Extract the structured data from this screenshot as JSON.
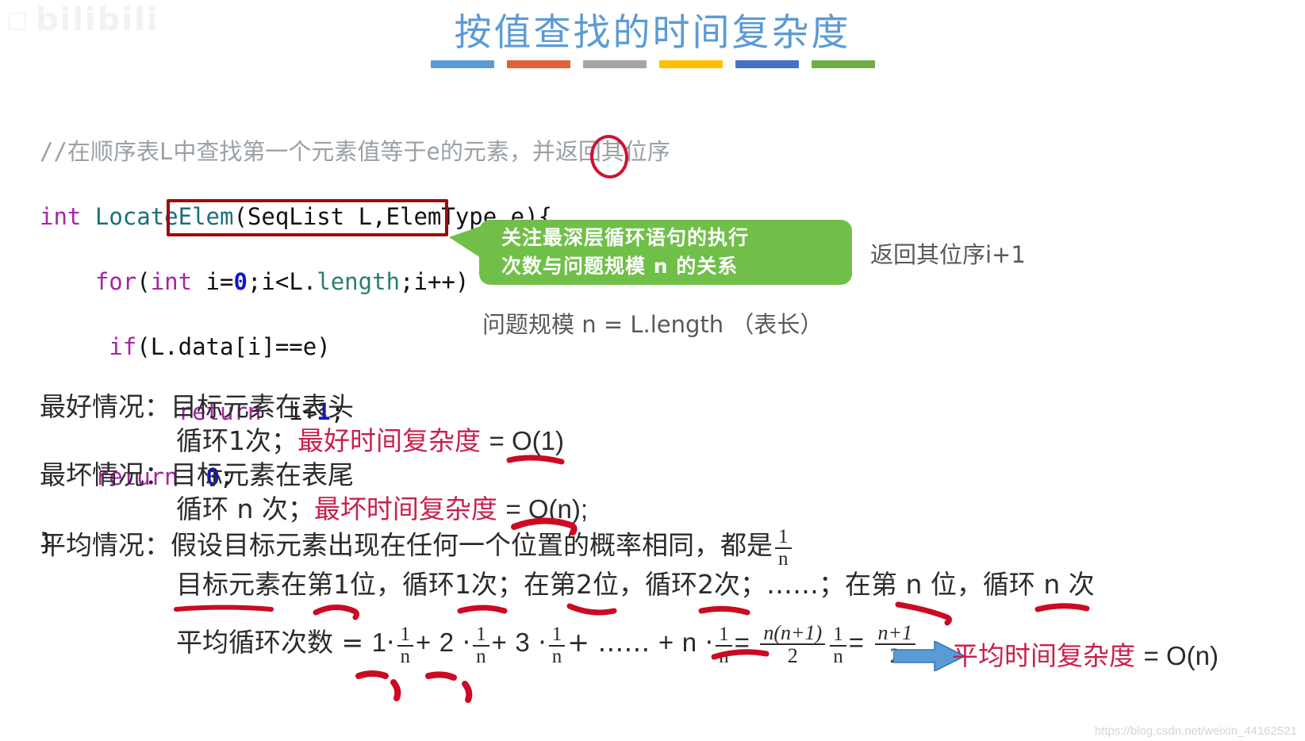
{
  "watermark": {
    "brand": "bilibili",
    "mark_icon": "tv-logo-icon",
    "bottom_url": "https://blog.csdn.net/weixin_44162521"
  },
  "slide": {
    "title": "按值查找的时间复杂度",
    "rule_colors": [
      "#5b9bd5",
      "#e1613c",
      "#a5a5a5",
      "#ffc000",
      "#4472c4",
      "#70ad47"
    ]
  },
  "code": {
    "comment": "//在顺序表L中查找第一个元素值等于e的元素，并返回其位序",
    "line_signature": {
      "kw": "int",
      "fn": "LocateElem",
      "rest": "(SeqList L,ElemType e){"
    },
    "line_for": {
      "kw": "for",
      "text": "(int i=0;i<L.length;i++)"
    },
    "line_if": "if(L.data[i]==e)",
    "line_return1": {
      "kw": "return",
      "val": "i+1;"
    },
    "line_return0": {
      "kw": "return",
      "val": "0;"
    },
    "line_close": "}",
    "box_color": "#9e0b0b",
    "circle_color": "#cf1233"
  },
  "callout": {
    "line1": "关注最深层循环语句的执行",
    "line2": "次数与问题规模 n 的关系",
    "color": "#70bf48"
  },
  "annotations": {
    "return_note": "返回其位序i+1",
    "scale_note": "问题规模 n = L.length （表长）"
  },
  "cases": {
    "best": {
      "label": "最好情况：",
      "desc": "目标元素在表头",
      "detail_prefix": "循环1次；",
      "complexity_label": "最好时间复杂度",
      "complexity_value": "= O(1)"
    },
    "worst": {
      "label": "最坏情况：",
      "desc": "目标元素在表尾",
      "detail_prefix": "循环 n 次；",
      "complexity_label": "最坏时间复杂度",
      "complexity_value": "= O(n);"
    },
    "average": {
      "label": "平均情况：",
      "desc": "假设目标元素出现在任何一个位置的概率相同，都是",
      "prob_numerator": "1",
      "prob_denominator": "n",
      "positions": "目标元素在第1位，循环1次；在第2位，循环2次；……；在第 n 位，循环 n 次",
      "formula_label": "平均循环次数 =",
      "formula_terms": [
        {
          "coef": "1",
          "op": "·"
        },
        {
          "coef": "2",
          "op": "·"
        },
        {
          "coef": "3",
          "op": "·"
        }
      ],
      "formula_ellipsis": "+ ……",
      "formula_last_coef": "n",
      "formula_eq1": "=",
      "sum_numerator": "n(n+1)",
      "sum_denominator": "2",
      "formula_eq2": "=",
      "result_numerator": "n+1",
      "result_denominator": "2",
      "conclusion_label": "平均时间复杂度",
      "conclusion_value": "= O(n)",
      "arrow_color": "#5b9bd5"
    }
  },
  "ink": {
    "color": "#cc0a22"
  }
}
